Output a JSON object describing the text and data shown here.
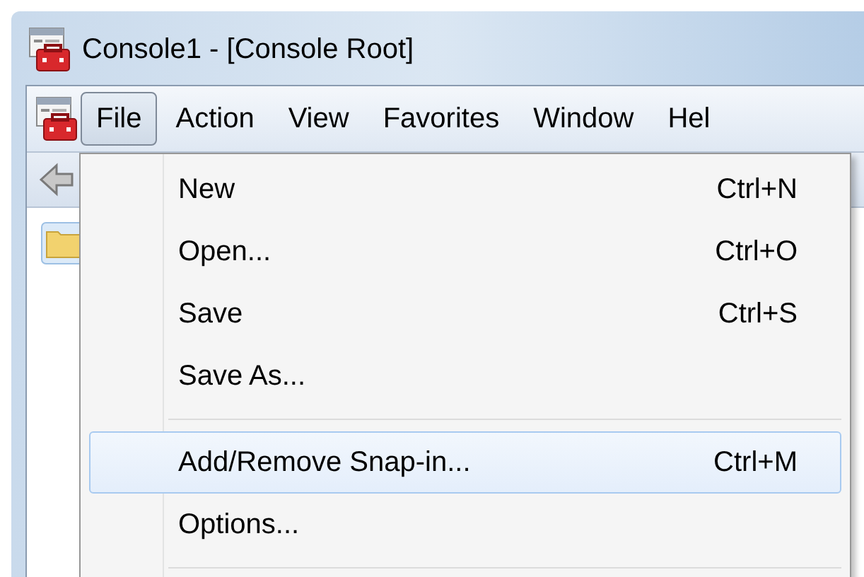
{
  "window": {
    "title": "Console1 - [Console Root]"
  },
  "menu_bar": [
    {
      "label": "File",
      "selected": true
    },
    {
      "label": "Action",
      "selected": false
    },
    {
      "label": "View",
      "selected": false
    },
    {
      "label": "Favorites",
      "selected": false
    },
    {
      "label": "Window",
      "selected": false
    },
    {
      "label": "Hel",
      "selected": false
    }
  ],
  "file_menu": [
    {
      "kind": "item",
      "label": "New",
      "shortcut": "Ctrl+N",
      "selected": false
    },
    {
      "kind": "item",
      "label": "Open...",
      "shortcut": "Ctrl+O",
      "selected": false
    },
    {
      "kind": "item",
      "label": "Save",
      "shortcut": "Ctrl+S",
      "selected": false
    },
    {
      "kind": "item",
      "label": "Save As...",
      "selected": false
    },
    {
      "kind": "separator"
    },
    {
      "kind": "item",
      "label": "Add/Remove Snap-in...",
      "shortcut": "Ctrl+M",
      "selected": true
    },
    {
      "kind": "item",
      "label": "Options...",
      "selected": false
    },
    {
      "kind": "separator"
    }
  ]
}
